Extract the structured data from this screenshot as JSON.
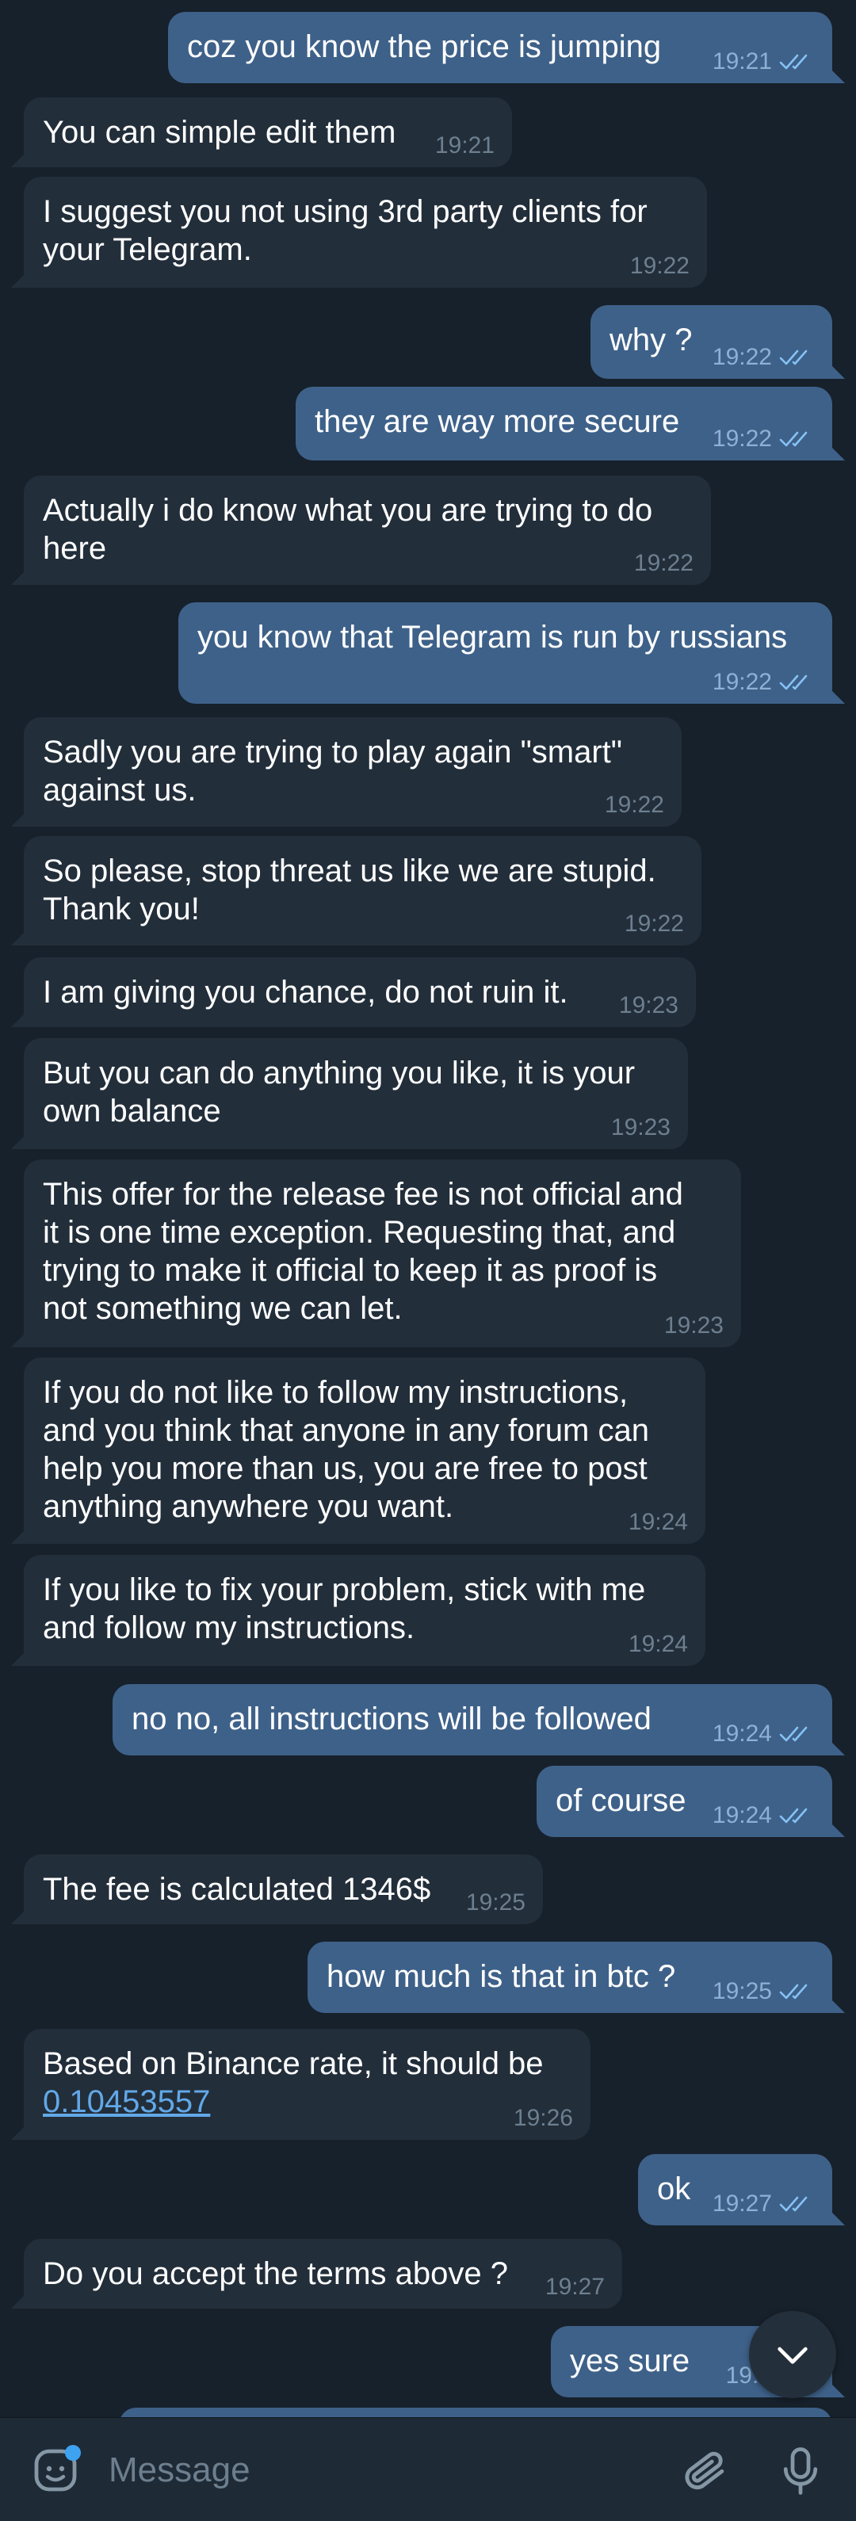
{
  "messages": [
    {
      "dir": "out",
      "text": "coz you know the price is jumping",
      "time": "19:21",
      "read": true
    },
    {
      "dir": "in",
      "text": "You can simple edit them",
      "time": "19:21"
    },
    {
      "dir": "in",
      "text": "I suggest you not using 3rd party clients for\nyour Telegram.",
      "time": "19:22"
    },
    {
      "dir": "out",
      "text": "why ?",
      "time": "19:22",
      "read": true
    },
    {
      "dir": "out",
      "text": "they are way more secure",
      "time": "19:22",
      "read": true
    },
    {
      "dir": "in",
      "text": "Actually i do know what you are trying to do\nhere",
      "time": "19:22"
    },
    {
      "dir": "out",
      "text": "you know that Telegram is run by russians",
      "time": "19:22",
      "read": true
    },
    {
      "dir": "in",
      "text": "Sadly you are trying to play again \"smart\"\nagainst us.",
      "time": "19:22"
    },
    {
      "dir": "in",
      "text": "So please, stop threat us like we are stupid.\nThank you!",
      "time": "19:22"
    },
    {
      "dir": "in",
      "text": "I am giving you chance, do not ruin it.",
      "time": "19:23"
    },
    {
      "dir": "in",
      "text": "But you can do anything you like, it is your\nown balance",
      "time": "19:23"
    },
    {
      "dir": "in",
      "text": "This offer for the release fee is not official and\nit is one time exception. Requesting that, and\ntrying to make it official to keep it as proof is\nnot something we can let.",
      "time": "19:23"
    },
    {
      "dir": "in",
      "text": "If you do not like to follow my instructions,\nand you think that anyone in any forum can\nhelp you more than us, you are free to post\nanything anywhere you want.",
      "time": "19:24"
    },
    {
      "dir": "in",
      "text": "If you like to fix your problem, stick with me\nand follow my instructions.",
      "time": "19:24"
    },
    {
      "dir": "out",
      "text": "no no, all instructions will be followed",
      "time": "19:24",
      "read": true
    },
    {
      "dir": "out",
      "text": "of course",
      "time": "19:24",
      "read": true
    },
    {
      "dir": "in",
      "text": "The fee is calculated 1346$",
      "time": "19:25"
    },
    {
      "dir": "out",
      "text": "how much is that in btc ?",
      "time": "19:25",
      "read": true
    },
    {
      "dir": "in",
      "text": "Based on Binance rate, it should be",
      "link": "0.10453557",
      "time": "19:26"
    },
    {
      "dir": "out",
      "text": "ok",
      "time": "19:27",
      "read": true
    },
    {
      "dir": "in",
      "text": "Do you accept the terms above ?",
      "time": "19:27"
    },
    {
      "dir": "out",
      "text": "yes sure",
      "time": "19:2",
      "read": true
    },
    {
      "dir": "out",
      "text": "",
      "time": "",
      "read": false
    }
  ],
  "composer": {
    "placeholder": "Message",
    "emoji_icon": "sticker-emoji-icon",
    "attach_icon": "paperclip-icon",
    "mic_icon": "microphone-icon"
  },
  "scroll_down_icon": "chevron-down-icon",
  "colors": {
    "background": "#17212b",
    "incoming_bubble": "#222e3a",
    "outgoing_bubble": "#3e6189",
    "link": "#62a8e8",
    "accent": "#5aa7e6"
  }
}
